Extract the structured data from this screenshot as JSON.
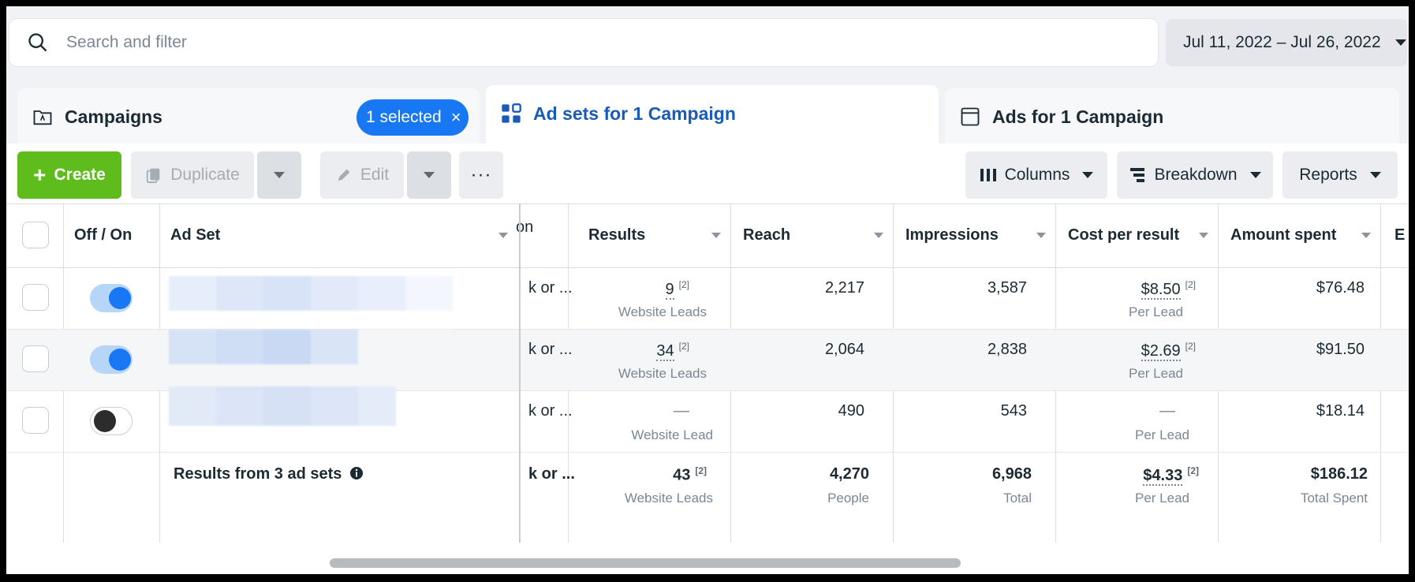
{
  "search": {
    "placeholder": "Search and filter"
  },
  "date_range": {
    "label": "Jul 11, 2022 – Jul 26, 2022"
  },
  "tabs": {
    "campaigns": {
      "label": "Campaigns",
      "badge": "1 selected",
      "badge_close": "×"
    },
    "adsets": {
      "label": "Ad sets for 1 Campaign"
    },
    "ads": {
      "label": "Ads for 1 Campaign"
    }
  },
  "toolbar": {
    "create": "Create",
    "duplicate": "Duplicate",
    "edit": "Edit",
    "more": "···",
    "columns": "Columns",
    "breakdown": "Breakdown",
    "reports": "Reports"
  },
  "table": {
    "headers": {
      "off_on": "Off / On",
      "ad_set": "Ad Set",
      "partial": "on",
      "results": "Results",
      "reach": "Reach",
      "impressions": "Impressions",
      "cost_per_result": "Cost per result",
      "amount_spent": "Amount spent",
      "next": "E"
    },
    "rows": [
      {
        "toggle": "on",
        "truncated": "k or ...",
        "results": "9",
        "results_sub": "Website Leads",
        "reach": "2,217",
        "impressions": "3,587",
        "cost": "$8.50",
        "cost_sub": "Per Lead",
        "spent": "$76.48",
        "sup": "[2]"
      },
      {
        "toggle": "on",
        "truncated": "k or ...",
        "results": "34",
        "results_sub": "Website Leads",
        "reach": "2,064",
        "impressions": "2,838",
        "cost": "$2.69",
        "cost_sub": "Per Lead",
        "spent": "$91.50",
        "sup": "[2]"
      },
      {
        "toggle": "off",
        "truncated": "k or ...",
        "results": "—",
        "results_sub": "Website Lead",
        "reach": "490",
        "impressions": "543",
        "cost": "—",
        "cost_sub": "Per Lead",
        "spent": "$18.14",
        "sup": ""
      }
    ],
    "summary": {
      "label": "Results from 3 ad sets",
      "truncated": "k or ...",
      "results": "43",
      "results_sub": "Website Leads",
      "reach": "4,270",
      "reach_sub": "People",
      "impressions": "6,968",
      "impressions_sub": "Total",
      "cost": "$4.33",
      "cost_sub": "Per Lead",
      "spent": "$186.12",
      "spent_sub": "Total Spent",
      "sup": "[2]"
    }
  },
  "colors": {
    "accent": "#1877f2",
    "create": "#5fbc1d",
    "tab_active": "#1a5bb8"
  }
}
